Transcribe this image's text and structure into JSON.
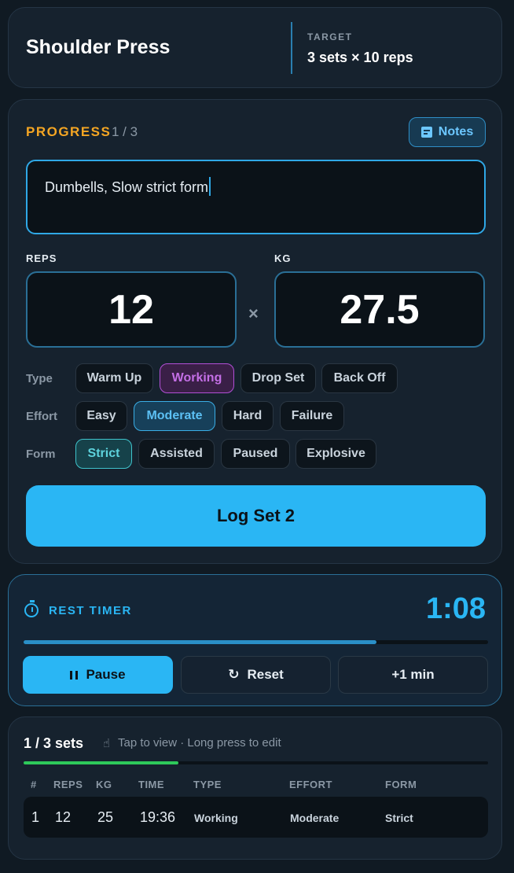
{
  "header": {
    "exercise_title": "Shoulder Press",
    "target_label": "TARGET",
    "target_value": "3 sets × 10 reps"
  },
  "progress": {
    "label": "PROGRESS",
    "count": "1 / 3",
    "notes_button": "Notes",
    "notes_text": "Dumbells, Slow strict form",
    "reps_label": "REPS",
    "reps_value": "12",
    "kg_label": "KG",
    "kg_value": "27.5",
    "times_symbol": "×",
    "type": {
      "label": "Type",
      "options": [
        "Warm Up",
        "Working",
        "Drop Set",
        "Back Off"
      ],
      "selected": "Working"
    },
    "effort": {
      "label": "Effort",
      "options": [
        "Easy",
        "Moderate",
        "Hard",
        "Failure"
      ],
      "selected": "Moderate"
    },
    "form": {
      "label": "Form",
      "options": [
        "Strict",
        "Assisted",
        "Paused",
        "Explosive"
      ],
      "selected": "Strict"
    },
    "log_button": "Log Set 2"
  },
  "rest_timer": {
    "label": "REST TIMER",
    "value": "1:08",
    "progress_fraction": 0.76,
    "buttons": {
      "pause": "Pause",
      "reset": "Reset",
      "add": "+1 min"
    }
  },
  "sets_log": {
    "count": "1 / 3 sets",
    "hint": "Tap to view · Long press to edit",
    "progress_fraction": 0.333,
    "columns": [
      "#",
      "REPS",
      "KG",
      "TIME",
      "TYPE",
      "EFFORT",
      "FORM"
    ],
    "rows": [
      {
        "n": "1",
        "reps": "12",
        "kg": "25",
        "time": "19:36",
        "type": "Working",
        "effort": "Moderate",
        "form": "Strict"
      }
    ]
  },
  "colors": {
    "accent": "#2ab6f4",
    "progress_label": "#f5a623",
    "working_selected": "#b24fd6",
    "effort_selected": "#3aaee6",
    "form_selected": "#3fc3cc",
    "sets_progress": "#2ec95a"
  },
  "icons": [
    "notes-icon",
    "timer-icon",
    "pause-icon",
    "reset-icon",
    "tap-icon"
  ]
}
